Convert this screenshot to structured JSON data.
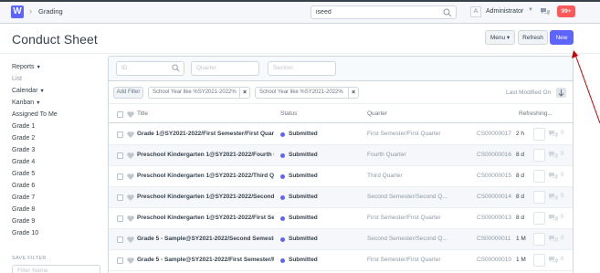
{
  "navbar": {
    "logo": "W",
    "breadcrumb": "Grading",
    "search_value": "iseed",
    "avatar_letter": "A",
    "user_name": "Administrator",
    "notifications": "99+"
  },
  "page": {
    "title": "Conduct Sheet",
    "menu_label": "Menu",
    "refresh_label": "Refresh",
    "new_label": "New"
  },
  "sidebar": {
    "items": [
      {
        "label": "Reports",
        "caret": true
      },
      {
        "label": "List",
        "muted": true
      },
      {
        "label": "Calendar",
        "caret": true
      },
      {
        "label": "Kanban",
        "caret": true
      },
      {
        "label": "Assigned To Me"
      },
      {
        "label": "Grade 1"
      },
      {
        "label": "Grade 2"
      },
      {
        "label": "Grade 3"
      },
      {
        "label": "Grade 4"
      },
      {
        "label": "Grade 5"
      },
      {
        "label": "Grade 6"
      },
      {
        "label": "Grade 7"
      },
      {
        "label": "Grade 8"
      },
      {
        "label": "Grade 9"
      },
      {
        "label": "Grade 10"
      }
    ],
    "save_filter_label": "SAVE FILTER",
    "filter_name_placeholder": "Filter Name"
  },
  "filters": {
    "id_placeholder": "ID",
    "quarter_placeholder": "Quarter",
    "section_placeholder": "Section",
    "add_filter_label": "Add Filter",
    "tags": [
      "School Year like %SY2021-2022%",
      "School Year like %SY2021-2022%"
    ],
    "last_modified_label": "Last Modified On"
  },
  "columns": {
    "title": "Title",
    "status": "Status",
    "quarter": "Quarter",
    "refreshing": "Refreshing..."
  },
  "rows": [
    {
      "title": "Grade 1@SY2021-2022/First Semester/First Quarter",
      "status": "Submitted",
      "quarter": "First Semester/First Quarter",
      "id": "CS00000017",
      "time": "2 h",
      "comments": "0"
    },
    {
      "title": "Preschool Kindergarten 1@SY2021-2022/Fourth Quarter",
      "status": "Submitted",
      "quarter": "Fourth Quarter",
      "id": "CS00000016",
      "time": "8 d",
      "comments": "0"
    },
    {
      "title": "Preschool Kindergarten 1@SY2021-2022/Third Quarter",
      "status": "Submitted",
      "quarter": "Third Quarter",
      "id": "CS00000015",
      "time": "8 d",
      "comments": "0"
    },
    {
      "title": "Preschool Kindergarten 1@SY2021-2022/Second Semester",
      "status": "Submitted",
      "quarter": "Second Semester/Second Q...",
      "id": "CS00000014",
      "time": "8 d",
      "comments": "0"
    },
    {
      "title": "Preschool Kindergarten 1@SY2021-2022/First Semester",
      "status": "Submitted",
      "quarter": "First Semester/First Quarter",
      "id": "CS00000013",
      "time": "8 d",
      "comments": "0"
    },
    {
      "title": "Grade 5 - Sample@SY2021-2022/Second Semester",
      "status": "Submitted",
      "quarter": "Second Semester/Second Q...",
      "id": "CS00000011",
      "time": "1 M",
      "comments": "0"
    },
    {
      "title": "Grade 5 - Sample@SY2021-2022/First Semester/First",
      "status": "Submitted",
      "quarter": "First Semester/First Quarter",
      "id": "CS00000010",
      "time": "1 M",
      "comments": "0"
    }
  ],
  "colors": {
    "brand": "#5e64ff",
    "notification": "#ff5858",
    "annotation_arrow": "#cc0000"
  }
}
